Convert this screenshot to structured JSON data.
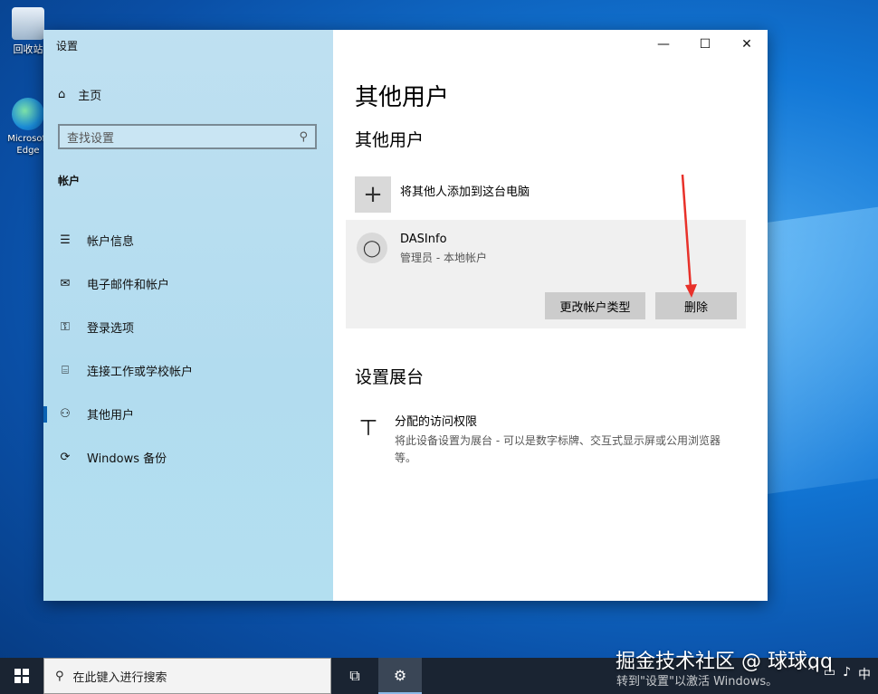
{
  "desktop": {
    "icons": [
      {
        "label": "回收站",
        "icon": "recycle-bin-icon"
      },
      {
        "label": "Microsoft Edge",
        "icon": "edge-icon"
      }
    ],
    "watermark": "掘金技术社区 @ 球球qq",
    "activation_text": "转到\"设置\"以激活 Windows。"
  },
  "window": {
    "title": "设置",
    "controls": {
      "minimize": "—",
      "maximize": "☐",
      "close": "✕"
    }
  },
  "sidebar": {
    "home_label": "主页",
    "search_placeholder": "查找设置",
    "section_label": "帐户",
    "items": [
      {
        "label": "帐户信息",
        "icon": "account-info-icon",
        "active": false
      },
      {
        "label": "电子邮件和帐户",
        "icon": "mail-icon",
        "active": false
      },
      {
        "label": "登录选项",
        "icon": "key-icon",
        "active": false
      },
      {
        "label": "连接工作或学校帐户",
        "icon": "briefcase-icon",
        "active": false
      },
      {
        "label": "其他用户",
        "icon": "add-person-icon",
        "active": true
      },
      {
        "label": "Windows 备份",
        "icon": "sync-icon",
        "active": false
      }
    ]
  },
  "main": {
    "page_title": "其他用户",
    "other_users_heading": "其他用户",
    "add_user_label": "将其他人添加到这台电脑",
    "user": {
      "name": "DASInfo",
      "role": "管理员 - 本地帐户",
      "change_type_button": "更改帐户类型",
      "remove_button": "删除"
    },
    "kiosk_heading": "设置展台",
    "kiosk": {
      "title": "分配的访问权限",
      "description": "将此设备设置为展台 - 可以是数字标牌、交互式显示屏或公用浏览器等。"
    }
  },
  "taskbar": {
    "search_placeholder": "在此键入进行搜索",
    "ime_label": "中"
  },
  "colors": {
    "accent": "#0a62b3",
    "arrow": "#e8312a"
  }
}
